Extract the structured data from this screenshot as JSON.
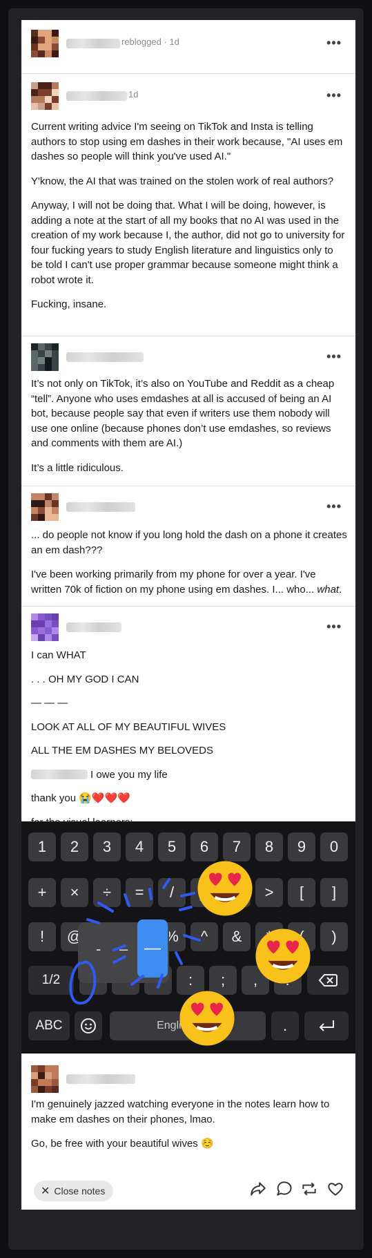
{
  "reblog_header": {
    "action": "reblogged",
    "time": "1d"
  },
  "post1": {
    "time": "1d",
    "paragraphs": [
      "Current writing advice I'm seeing on TikTok and Insta is telling authors to stop using em dashes in their work because, \"AI uses em dashes so people will think you've used AI.\"",
      "Y'know, the AI that was trained on the stolen work of real authors?",
      "Anyway, I will not be doing that. What I will be doing, however, is adding a note at the start of all my books that no AI was used in the creation of my work because I, the author, did not go to university for four fucking years to study English literature and linguistics only to be told I can't use proper grammar because someone might think a robot wrote it.",
      "Fucking, insane."
    ]
  },
  "post2": {
    "paragraphs": [
      "It’s not only on TikTok, it’s also on YouTube and Reddit as a cheap “tell”. Anyone who uses emdashes at all is accused of being an AI bot, because people say that even if writers use them nobody will use one online (because phones don’t use emdashes, so reviews and comments with them are AI.)",
      "It’s a little ridiculous."
    ]
  },
  "post3": {
    "p1": "... do people not know if you long hold the dash on a phone it creates an em dash???",
    "p2_start": "I've been working primarily from my phone for over a year. I've written 70k of fiction on my phone using em dashes. I... who... ",
    "p2_em": "what",
    "p2_end": "."
  },
  "post4": {
    "lines": [
      "I can WHAT",
      ". . . OH MY GOD I CAN",
      "— — —",
      "LOOK AT ALL OF MY BEAUTIFUL WIVES",
      "ALL THE EM DASHES MY BELOVEDS"
    ],
    "owe": "I owe you my life",
    "thanks": "thank you 😭❤️❤️❤️",
    "visual": "for the visual learners:"
  },
  "keyboard": {
    "row1": [
      "1",
      "2",
      "3",
      "4",
      "5",
      "6",
      "7",
      "8",
      "9",
      "0"
    ],
    "row2": [
      "+",
      "×",
      "÷",
      "=",
      "/",
      "_",
      "<",
      ">",
      "[",
      "]"
    ],
    "row3": [
      "!",
      "@",
      "#",
      "$",
      "%",
      "^",
      "&",
      "*",
      "(",
      ")"
    ],
    "row4": [
      "1/2",
      "-",
      "'",
      "\"",
      ":",
      ";",
      ",",
      "?"
    ],
    "abc": "ABC",
    "space": "English (US)",
    "period": ".",
    "popup": [
      "-",
      "–",
      "—"
    ],
    "backspace_icon": "backspace-icon",
    "enter_icon": "enter-icon",
    "emoji_icon": "emoji-icon",
    "accent": "#3f8df0"
  },
  "post5": {
    "p1": "I'm genuinely jazzed watching everyone in the notes learn how to make em dashes on their phones, lmao.",
    "p2": "Go, be free with your beautiful wives ☺️"
  },
  "footer": {
    "close_label": "Close notes",
    "icons": [
      "share-icon",
      "comment-icon",
      "reblog-icon",
      "heart-icon"
    ]
  }
}
